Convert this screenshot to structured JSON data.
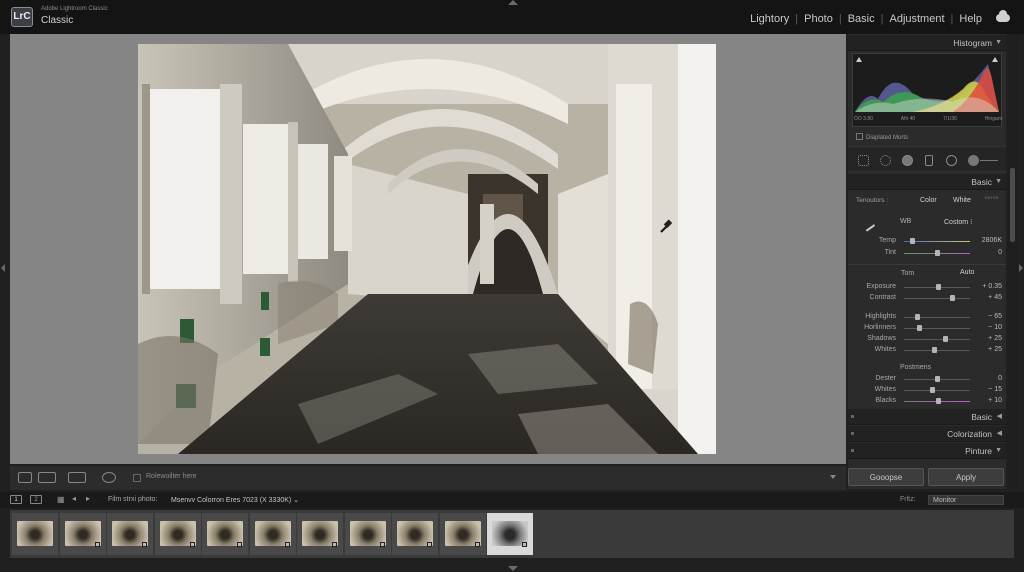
{
  "app": {
    "logo": "LrC",
    "product": "Adobe Lightroom Classic",
    "catalog": "Classic"
  },
  "modules": [
    "Lightory",
    "Photo",
    "Basic",
    "Adjustment",
    "Help"
  ],
  "toolbar": {
    "checkbox_label": "Rolewoilter here"
  },
  "panel": {
    "histogram": {
      "title": "Histogram",
      "info": [
        "ÖO 3.80",
        "Afö 40",
        "7/1/36",
        "Hingant"
      ],
      "mask_label": "Diaplated Morts"
    },
    "basic_title": "Basic",
    "treatment": {
      "label": "Tenoutors :",
      "color": "Color",
      "white": "White",
      "extra": "ENTER"
    },
    "wb": {
      "label": "WB",
      "value": "Costom"
    },
    "sliders_wb": [
      {
        "label": "Temp",
        "value": "2806K",
        "pos": 0.12
      },
      {
        "label": "Tint",
        "value": "0",
        "pos": 0.5
      }
    ],
    "tone": {
      "label": "Tom",
      "auto": "Auto"
    },
    "sliders_tone": [
      {
        "label": "Exposure",
        "value": "+ 0.35",
        "pos": 0.52
      },
      {
        "label": "Contrast",
        "value": "+ 45",
        "pos": 0.72
      }
    ],
    "sliders_tone2": [
      {
        "label": "Highlights",
        "value": "− 65",
        "pos": 0.2
      },
      {
        "label": "Horlinners",
        "value": "− 10",
        "pos": 0.22
      },
      {
        "label": "Shadows",
        "value": "+ 25",
        "pos": 0.62
      },
      {
        "label": "Whites",
        "value": "+ 25",
        "pos": 0.45
      }
    ],
    "presence": {
      "label": "Postmens"
    },
    "sliders_presence": [
      {
        "label": "Dester",
        "value": "0",
        "pos": 0.5
      },
      {
        "label": "Whites",
        "value": "− 15",
        "pos": 0.42
      },
      {
        "label": "Blacks",
        "value": "+ 10",
        "pos": 0.52
      }
    ],
    "sections": [
      "Basic",
      "Colorization",
      "Pinture"
    ],
    "buttons": {
      "left": "Gooopse",
      "right": "Apply"
    }
  },
  "filmbar": {
    "page1": "1",
    "page2": "2",
    "source_label": "Film strxi photo:",
    "source_name": "Msenvv Colorron Eres 7023 (X 3330K)",
    "filter_label": "Frltz:",
    "filter_value": "Monitor"
  },
  "filmstrip": {
    "count": 11,
    "selected_index": 10
  },
  "colors": {
    "accent": "#2b2b2b",
    "photo_tint": "#c9c0ad"
  }
}
